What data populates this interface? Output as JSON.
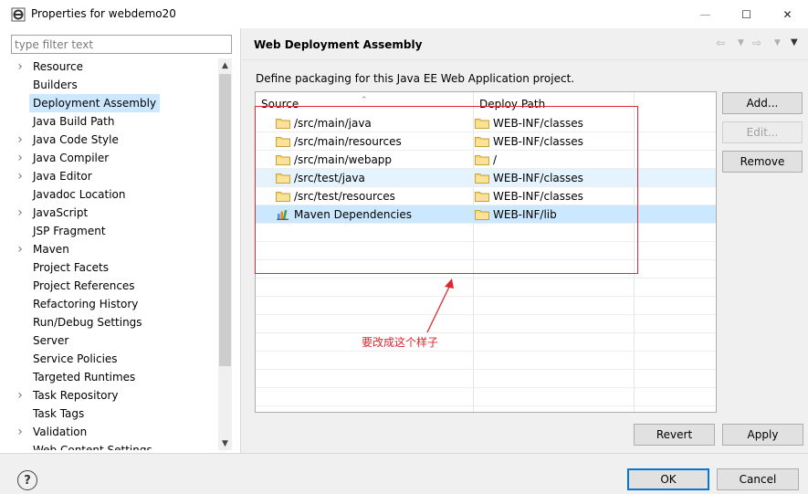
{
  "window": {
    "title": "Properties for webdemo20",
    "min_glyph": "—",
    "max_glyph": "☐",
    "close_glyph": "✕"
  },
  "filter": {
    "placeholder": "type filter text",
    "value": ""
  },
  "tree": {
    "items": [
      {
        "label": "Resource",
        "expandable": true
      },
      {
        "label": "Builders",
        "expandable": false
      },
      {
        "label": "Deployment Assembly",
        "expandable": false,
        "selected": true
      },
      {
        "label": "Java Build Path",
        "expandable": false
      },
      {
        "label": "Java Code Style",
        "expandable": true
      },
      {
        "label": "Java Compiler",
        "expandable": true
      },
      {
        "label": "Java Editor",
        "expandable": true
      },
      {
        "label": "Javadoc Location",
        "expandable": false
      },
      {
        "label": "JavaScript",
        "expandable": true
      },
      {
        "label": "JSP Fragment",
        "expandable": false
      },
      {
        "label": "Maven",
        "expandable": true
      },
      {
        "label": "Project Facets",
        "expandable": false
      },
      {
        "label": "Project References",
        "expandable": false
      },
      {
        "label": "Refactoring History",
        "expandable": false
      },
      {
        "label": "Run/Debug Settings",
        "expandable": false
      },
      {
        "label": "Server",
        "expandable": false
      },
      {
        "label": "Service Policies",
        "expandable": false
      },
      {
        "label": "Targeted Runtimes",
        "expandable": false
      },
      {
        "label": "Task Repository",
        "expandable": true
      },
      {
        "label": "Task Tags",
        "expandable": false
      },
      {
        "label": "Validation",
        "expandable": true
      },
      {
        "label": "Web Content Settings",
        "expandable": false
      }
    ]
  },
  "page": {
    "title": "Web Deployment Assembly",
    "description": "Define packaging for this Java EE Web Application project."
  },
  "table": {
    "columns": {
      "source": "Source",
      "deploy": "Deploy Path"
    },
    "rows": [
      {
        "source": "/src/main/java",
        "deploy": "WEB-INF/classes",
        "icon": "folder-icon",
        "state": "normal"
      },
      {
        "source": "/src/main/resources",
        "deploy": "WEB-INF/classes",
        "icon": "folder-icon",
        "state": "normal"
      },
      {
        "source": "/src/main/webapp",
        "deploy": "/",
        "icon": "folder-icon",
        "state": "normal"
      },
      {
        "source": "/src/test/java",
        "deploy": "WEB-INF/classes",
        "icon": "folder-icon",
        "state": "hover"
      },
      {
        "source": "/src/test/resources",
        "deploy": "WEB-INF/classes",
        "icon": "folder-icon",
        "state": "normal"
      },
      {
        "source": "Maven Dependencies",
        "deploy": "WEB-INF/lib",
        "icon": "library-icon",
        "state": "selected"
      }
    ]
  },
  "buttons": {
    "add": "Add...",
    "edit": "Edit...",
    "remove": "Remove",
    "revert": "Revert",
    "apply": "Apply",
    "ok": "OK",
    "cancel": "Cancel",
    "help": "?"
  },
  "annotation": {
    "text": "要改成这个样子",
    "color": "#e0262e"
  },
  "colors": {
    "selection": "#cce8ff",
    "hover": "#e5f3ff",
    "default_button_border": "#0078d7"
  }
}
